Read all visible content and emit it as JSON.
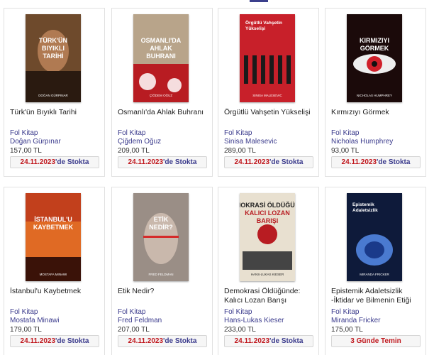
{
  "products": [
    {
      "title": "Türk'ün Bıyıklı Tarihi",
      "publisher": "Fol Kitap",
      "author": "Doğan Gürpınar",
      "price": "157,00 TL",
      "stock_date": "24.11.2023",
      "stock_suffix": "'de Stokta",
      "cover": {
        "bg": "#6e4a2c",
        "accent": "#2a1a10",
        "line1": "TÜRK'ÜN",
        "line2": "BIYIKLI",
        "line3": "TARİHİ",
        "author_line": "DOĞAN GÜRPINAR"
      }
    },
    {
      "title": "Osmanlı'da Ahlak Buhranı",
      "publisher": "Fol Kitap",
      "author": "Çiğdem Oğuz",
      "price": "209,00 TL",
      "stock_date": "24.11.2023",
      "stock_suffix": "'de Stokta",
      "cover": {
        "bg": "#b8a48a",
        "accent": "#b81c22",
        "line1": "OSMANLI'DA",
        "line2": "AHLAK",
        "line3": "BUHRANI",
        "author_line": "ÇİĞDEM OĞUZ"
      }
    },
    {
      "title": "Örgütlü Vahşetin Yükselişi",
      "publisher": "Fol Kitap",
      "author": "Sinisa Malesevic",
      "price": "289,00 TL",
      "stock_date": "24.11.2023",
      "stock_suffix": "'de Stokta",
      "cover": {
        "bg": "#c8202a",
        "accent": "#1a1a1a",
        "line1": "Örgütlü Vahşetin",
        "line2": "Yükselişi",
        "line3": "",
        "author_line": "SINISA MALESEVIC"
      }
    },
    {
      "title": "Kırmızıyı Görmek",
      "publisher": "Fol Kitap",
      "author": "Nicholas Humphrey",
      "price": "93,00 TL",
      "stock_date": "24.11.2023",
      "stock_suffix": "'de Stokta",
      "cover": {
        "bg": "#1b0a0a",
        "accent": "#d0202a",
        "line1": "KIRMIZIYI",
        "line2": "GÖRMEK",
        "line3": "",
        "author_line": "NICHOLAS HUMPHREY"
      }
    },
    {
      "title": "İstanbul'u Kaybetmek",
      "publisher": "Fol Kitap",
      "author": "Mostafa Minawi",
      "price": "179,00 TL",
      "stock_date": "24.11.2023",
      "stock_suffix": "'de Stokta",
      "cover": {
        "bg": "#c2401c",
        "accent": "#3a1208",
        "line1": "İSTANBUL'U",
        "line2": "KAYBETMEK",
        "line3": "",
        "author_line": "MOSTAFA MINAWI"
      }
    },
    {
      "title": "Etik Nedir?",
      "publisher": "Fol Kitap",
      "author": "Fred Feldman",
      "price": "207,00 TL",
      "stock_date": "24.11.2023",
      "stock_suffix": "'de Stokta",
      "cover": {
        "bg": "#9a8e86",
        "accent": "#d52a2a",
        "line1": "ETİK",
        "line2": "NEDİR?",
        "line3": "",
        "author_line": "FRED FELDMAN"
      }
    },
    {
      "title": "Demokrasi Öldüğünde: Kalıcı Lozan Barışı",
      "publisher": "Fol Kitap",
      "author": "Hans-Lukas Kieser",
      "price": "233,00 TL",
      "stock_date": "24.11.2023",
      "stock_suffix": "'de Stokta",
      "cover": {
        "bg": "#e8e0d0",
        "accent": "#b81c22",
        "line1": "DEMOKRASİ ÖLDÜĞÜNDE",
        "line2": "KALICI LOZAN",
        "line3": "BARIŞI",
        "author_line": "HANS-LUKAS KIESER"
      }
    },
    {
      "title": "Epistemik Adaletsizlik -İktidar ve Bilmenin Etiği",
      "publisher": "Fol Kitap",
      "author": "Miranda Fricker",
      "price": "175,00 TL",
      "stock_date": "",
      "stock_suffix": "3 Günde Temin",
      "cover": {
        "bg": "#0e1a3a",
        "accent": "#4a7ad0",
        "line1": "Epistemik",
        "line2": "Adaletsizlik",
        "line3": "",
        "author_line": "MIRANDA FRICKER"
      }
    }
  ]
}
